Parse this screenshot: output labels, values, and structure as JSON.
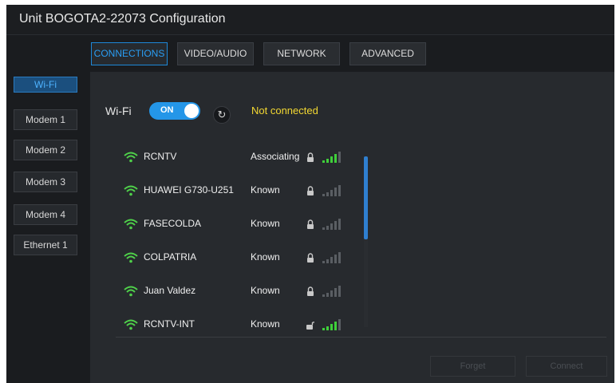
{
  "window": {
    "title": "Unit BOGOTA2-22073 Configuration"
  },
  "tabs": [
    {
      "label": "CONNECTIONS",
      "active": true
    },
    {
      "label": "VIDEO/AUDIO",
      "active": false
    },
    {
      "label": "NETWORK",
      "active": false
    },
    {
      "label": "ADVANCED",
      "active": false
    }
  ],
  "sidebar": {
    "items": [
      {
        "label": "Wi-Fi",
        "active": true
      },
      {
        "label": "Modem 1"
      },
      {
        "label": "Modem 2"
      },
      {
        "label": "Modem 3"
      },
      {
        "label": "Modem 4"
      },
      {
        "label": "Ethernet 1"
      }
    ]
  },
  "wifi": {
    "label": "Wi-Fi",
    "toggle_label": "ON",
    "enabled": true,
    "status": "Not connected",
    "status_color": "#f3d832"
  },
  "networks": [
    {
      "name": "RCNTV",
      "status": "Associating",
      "locked": true,
      "signal": 3
    },
    {
      "name": "HUAWEI G730-U251",
      "status": "Known",
      "locked": true,
      "signal": 0
    },
    {
      "name": "FASECOLDA",
      "status": "Known",
      "locked": true,
      "signal": 0
    },
    {
      "name": "COLPATRIA",
      "status": "Known",
      "locked": true,
      "signal": 0
    },
    {
      "name": "Juan Valdez",
      "status": "Known",
      "locked": true,
      "signal": 0
    },
    {
      "name": "RCNTV-INT",
      "status": "Known",
      "locked": false,
      "signal": 3
    }
  ],
  "actions": {
    "forget_label": "Forget",
    "connect_label": "Connect",
    "enabled": false
  },
  "colors": {
    "accent": "#2496e8",
    "wifi_icon": "#4fd14a",
    "signal_on": "#3fcf3a",
    "signal_off": "#5a5e63"
  }
}
